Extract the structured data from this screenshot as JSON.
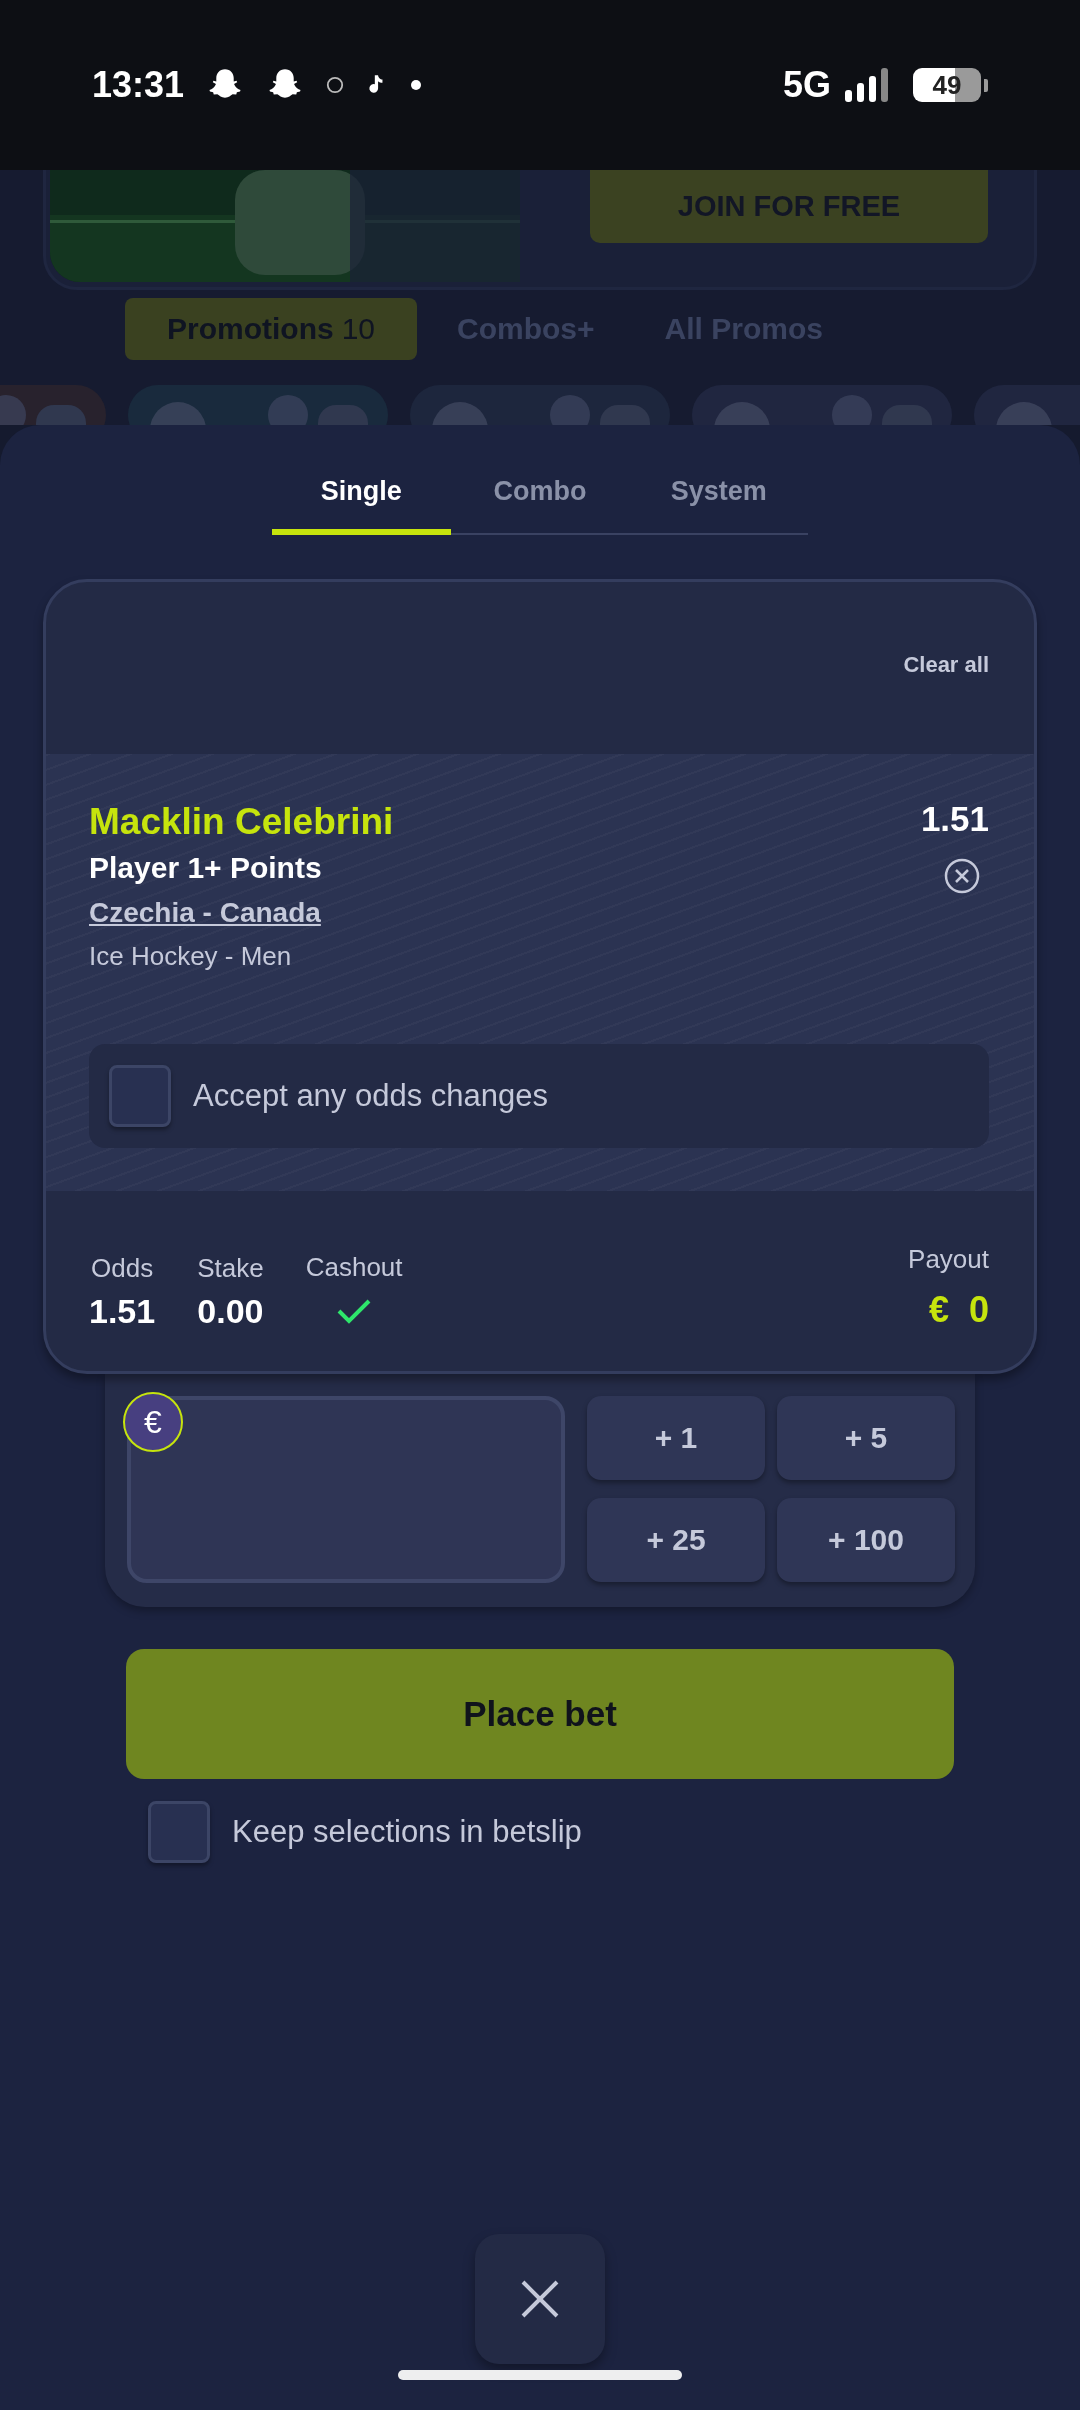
{
  "status_bar": {
    "time": "13:31",
    "network": "5G",
    "battery": "49"
  },
  "banner": {
    "button": "JOIN FOR FREE"
  },
  "promo_tabs": [
    {
      "label": "Promotions",
      "count": "10",
      "selected": true
    },
    {
      "label": "Combos+",
      "selected": false
    },
    {
      "label": "All Promos",
      "selected": false
    }
  ],
  "bet_tabs": [
    {
      "label": "Single",
      "selected": true
    },
    {
      "label": "Combo",
      "selected": false
    },
    {
      "label": "System",
      "selected": false
    }
  ],
  "betslip": {
    "clear_all": "Clear all",
    "selection": {
      "player": "Macklin Celebrini",
      "market": "Player 1+ Points",
      "event": "Czechia - Canada",
      "league": "Ice Hockey - Men",
      "odds": "1.51"
    },
    "accept_odds": {
      "label": "Accept any odds changes",
      "checked": false
    },
    "summary": {
      "odds_label": "Odds",
      "odds": "1.51",
      "stake_label": "Stake",
      "stake": "0.00",
      "cashout_label": "Cashout",
      "cashout": true,
      "payout_label": "Payout",
      "currency": "€",
      "payout": "0"
    }
  },
  "stake_input": {
    "currency": "€"
  },
  "quick_stakes": [
    "+ 1",
    "+ 5",
    "+ 25",
    "+ 100"
  ],
  "place_bet": "Place bet",
  "keep_selections": {
    "label": "Keep selections in betslip",
    "checked": false
  }
}
